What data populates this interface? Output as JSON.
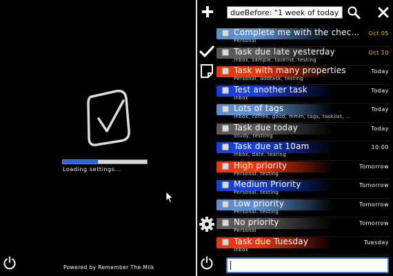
{
  "splash": {
    "loading_text": "Loading settings...",
    "powered_by": "Powered by Remember The Milk",
    "progress_fraction": 0.42,
    "progress_color": "#2a63d8"
  },
  "toolbar": {
    "search_value": "dueBefore: \"1 week of today\"",
    "icons": [
      "add-icon",
      "search-icon",
      "close-icon",
      "checkmark-icon",
      "note-icon",
      "gear-icon",
      "power-icon"
    ]
  },
  "colors": {
    "priority_1": "#e8380f",
    "priority_2": "#1a3fd6",
    "priority_3": "#5d8fd0",
    "priority_none": "#5a5a5a",
    "due_overdue": "#f4d000",
    "due_normal": "#ffffff"
  },
  "tasks": [
    {
      "title": "Complete me with the chec...",
      "tags": "Personal",
      "due": "Oct 05",
      "priority": "3",
      "overdue": true
    },
    {
      "title": "Task due late yesterday",
      "tags": "Inbox, sample, tasklist, testing",
      "due": "Oct 10",
      "priority": "none",
      "overdue": true
    },
    {
      "title": "Task with many properties",
      "tags": "Personal, addtask, testing",
      "due": "Today",
      "priority": "1",
      "overdue": false
    },
    {
      "title": "Test another task",
      "tags": "Inbox",
      "due": "Today",
      "priority": "2",
      "overdue": false
    },
    {
      "title": "Lots of tags",
      "tags": "Inbox, coffee, good, mmm, tags, tasklist, ...",
      "due": "Today",
      "priority": "3",
      "overdue": false
    },
    {
      "title": "Task due today",
      "tags": "Study, testiing",
      "due": "Today",
      "priority": "none",
      "overdue": false
    },
    {
      "title": "Task due at 10am",
      "tags": "Inbox, date, testing",
      "due": "10:00",
      "priority": "2",
      "overdue": false
    },
    {
      "title": "High priority",
      "tags": "Personal, testing",
      "due": "Tomorrow",
      "priority": "1",
      "overdue": false
    },
    {
      "title": "Medium Priority",
      "tags": "Personal, testing",
      "due": "Tomorrow",
      "priority": "2",
      "overdue": false
    },
    {
      "title": "Low priority",
      "tags": "Personal, testing",
      "due": "Tomorrow",
      "priority": "3",
      "overdue": false
    },
    {
      "title": "No priority",
      "tags": "Personal",
      "due": "Tomorrow",
      "priority": "none",
      "overdue": false
    },
    {
      "title": "Task due Tuesday",
      "tags": "Inbox",
      "due": "Tuesday",
      "priority": "1",
      "overdue": false
    }
  ]
}
